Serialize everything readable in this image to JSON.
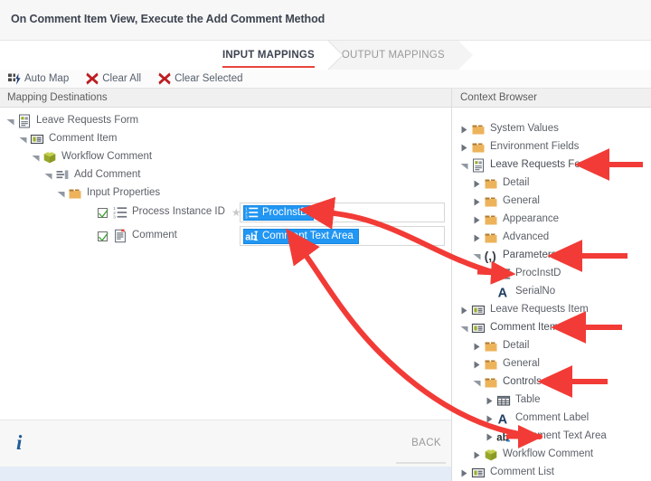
{
  "window": {
    "title": "On Comment Item View, Execute the Add Comment Method"
  },
  "tabs": [
    {
      "label": "INPUT MAPPINGS",
      "active": true
    },
    {
      "label": "OUTPUT MAPPINGS",
      "active": false
    }
  ],
  "toolbar": {
    "auto_map_label": "Auto Map",
    "clear_all_label": "Clear All",
    "clear_selected_label": "Clear Selected"
  },
  "columns": {
    "left_header": "Mapping Destinations",
    "right_header": "Context Browser"
  },
  "mapping_tree": [
    {
      "label": "Leave Requests Form",
      "depth": 0,
      "twist": "expanded",
      "icon": "form-icon"
    },
    {
      "label": "Comment Item",
      "depth": 1,
      "twist": "expanded",
      "icon": "view-icon"
    },
    {
      "label": "Workflow Comment",
      "depth": 2,
      "twist": "expanded",
      "icon": "cube-icon"
    },
    {
      "label": "Add Comment",
      "depth": 3,
      "twist": "expanded",
      "icon": "method-icon"
    },
    {
      "label": "Input Properties",
      "depth": 4,
      "twist": "expanded",
      "icon": "folder-icon"
    }
  ],
  "mapping_rows": [
    {
      "label": "Process Instance ID",
      "checked": true,
      "icon": "number-list-icon",
      "required": true,
      "value": "ProcInstD",
      "value_icon": "number-list-icon"
    },
    {
      "label": "Comment",
      "checked": true,
      "icon": "text-doc-icon",
      "required": false,
      "value": "Comment Text Area",
      "value_icon": "textarea-icon"
    }
  ],
  "context_tree": [
    {
      "label": "System Values",
      "depth": 0,
      "twist": "collapsed",
      "icon": "folder-icon"
    },
    {
      "label": "Environment Fields",
      "depth": 0,
      "twist": "collapsed",
      "icon": "folder-icon"
    },
    {
      "label": "Leave Requests Form",
      "depth": 0,
      "twist": "expanded",
      "icon": "form-icon",
      "highlighted": true
    },
    {
      "label": "Detail",
      "depth": 1,
      "twist": "collapsed",
      "icon": "folder-icon"
    },
    {
      "label": "General",
      "depth": 1,
      "twist": "collapsed",
      "icon": "folder-icon"
    },
    {
      "label": "Appearance",
      "depth": 1,
      "twist": "collapsed",
      "icon": "folder-icon"
    },
    {
      "label": "Advanced",
      "depth": 1,
      "twist": "collapsed",
      "icon": "folder-icon"
    },
    {
      "label": "Parameters",
      "depth": 1,
      "twist": "expanded",
      "icon": "parameters-icon",
      "highlighted": true
    },
    {
      "label": "ProcInstD",
      "depth": 2,
      "twist": "none",
      "icon": "number-list-icon"
    },
    {
      "label": "SerialNo",
      "depth": 2,
      "twist": "none",
      "icon": "text-a-icon"
    },
    {
      "label": "Leave Requests Item",
      "depth": 0,
      "twist": "collapsed",
      "icon": "view-icon"
    },
    {
      "label": "Comment Item",
      "depth": 0,
      "twist": "expanded",
      "icon": "view-icon",
      "highlighted": true
    },
    {
      "label": "Detail",
      "depth": 1,
      "twist": "collapsed",
      "icon": "folder-icon"
    },
    {
      "label": "General",
      "depth": 1,
      "twist": "collapsed",
      "icon": "folder-icon"
    },
    {
      "label": "Controls",
      "depth": 1,
      "twist": "expanded",
      "icon": "folder-icon",
      "highlighted": true
    },
    {
      "label": "Table",
      "depth": 2,
      "twist": "collapsed",
      "icon": "table-icon"
    },
    {
      "label": "Comment Label",
      "depth": 2,
      "twist": "collapsed",
      "icon": "text-a-icon"
    },
    {
      "label": "Comment Text Area",
      "depth": 2,
      "twist": "collapsed",
      "icon": "textarea-icon"
    },
    {
      "label": "Workflow Comment",
      "depth": 1,
      "twist": "collapsed",
      "icon": "cube-icon"
    },
    {
      "label": "Comment List",
      "depth": 0,
      "twist": "collapsed",
      "icon": "view-icon"
    }
  ],
  "footer": {
    "info_label": "i",
    "back_label": "BACK"
  },
  "colors": {
    "accent_red": "#e8453c",
    "selection_blue": "#2196f3",
    "annotation_red": "#f23b36",
    "folder_orange": "#e8a33d",
    "checkbox_green": "#3fa037",
    "title_text": "#3d4450"
  },
  "annotations": {
    "arrow_count": 5,
    "targets": [
      "Leave Requests Form",
      "Parameters",
      "Comment Item",
      "Controls",
      "ProcInstD value chip",
      "Comment Text Area value chip"
    ]
  }
}
